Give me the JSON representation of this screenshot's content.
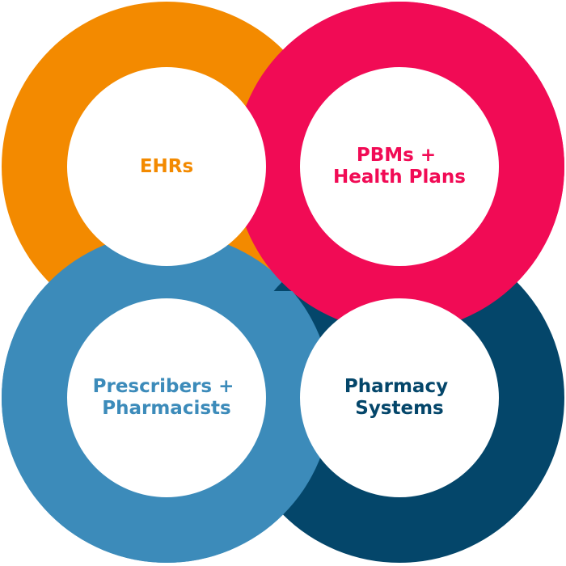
{
  "colors": {
    "ehrs": "#F38A00",
    "pbms": "#F10B55",
    "prescribers": "#3C8BBA",
    "pharmacy": "#04466A",
    "hole": "#FFFFFF"
  },
  "rings": {
    "ehrs": {
      "lines": [
        "EHRs"
      ]
    },
    "pbms": {
      "lines": [
        "PBMs +",
        "Health Plans"
      ]
    },
    "prescribers": {
      "lines": [
        "Prescribers +",
        "Pharmacists"
      ]
    },
    "pharmacy": {
      "lines": [
        "Pharmacy",
        "Systems"
      ]
    }
  }
}
